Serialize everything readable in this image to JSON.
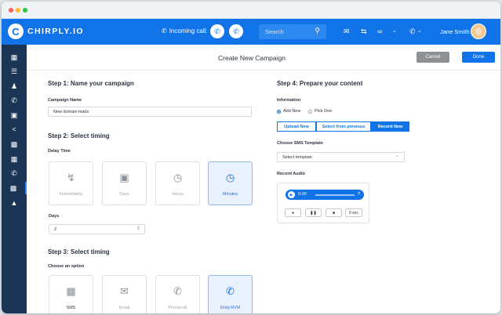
{
  "window": {
    "controls": [
      "close",
      "minimize",
      "zoom"
    ]
  },
  "brand": {
    "logo_letter": "C",
    "name": "CHIRPLY.IO"
  },
  "topbar": {
    "incoming_label": "Incoming call:",
    "search_placeholder": "Search",
    "user_name": "Jane Smith",
    "icons": [
      "mail-icon",
      "transfer-icon",
      "voicemail-icon",
      "chevron-down-icon",
      "phone-icon",
      "chevron-down-icon"
    ]
  },
  "sidebar": {
    "items": [
      "dashboard-icon",
      "list-icon",
      "contacts-icon",
      "phone-icon",
      "inbox-icon",
      "share-icon",
      "contact-card-icon",
      "apps-icon",
      "call-forward-icon",
      "calendar-icon",
      "education-icon"
    ],
    "active_index": 9
  },
  "page": {
    "title": "Create New Campaign",
    "cancel_label": "Cancel",
    "done_label": "Done"
  },
  "step1": {
    "heading": "Step 1: Name your campaign",
    "field_label": "Campaign Name",
    "field_value": "New domain leads"
  },
  "step2": {
    "heading": "Step 2: Select timing",
    "delay_label": "Delay Time",
    "options": [
      {
        "label": "Immediately",
        "icon": "lightning-icon",
        "selected": false
      },
      {
        "label": "Days",
        "icon": "calendar-icon",
        "selected": false
      },
      {
        "label": "Hours",
        "icon": "clock-icon",
        "selected": false
      },
      {
        "label": "Minutes",
        "icon": "stopwatch-icon",
        "selected": true
      }
    ],
    "days_label": "Days",
    "days_value": "2"
  },
  "step3": {
    "heading": "Step 3: Select timing",
    "choose_label": "Choose an option",
    "options": [
      {
        "label": "SMS",
        "icon": "message-icon",
        "selected": false
      },
      {
        "label": "Email",
        "icon": "envelope-icon",
        "selected": false
      },
      {
        "label": "Phonecall",
        "icon": "phone-icon",
        "selected": false
      },
      {
        "label": "Drop RVM",
        "icon": "voicemail-phone-icon",
        "selected": true
      }
    ]
  },
  "step4": {
    "heading": "Step 4: Prepare your content",
    "info_label": "Information",
    "radio_add_new": "Add New",
    "radio_pick_one": "Pick One",
    "tab_upload": "Upload New",
    "tab_select": "Select from previous",
    "tab_record": "Record New",
    "sms_template_label": "Choose SMS Template",
    "sms_template_placeholder": "Select template",
    "record_label": "Record Audio",
    "player_time": "0:00",
    "rec_counter": "0 sec"
  },
  "colors": {
    "primary": "#1173e8",
    "sidebar": "#1b3557",
    "cancel": "#8c9196"
  }
}
